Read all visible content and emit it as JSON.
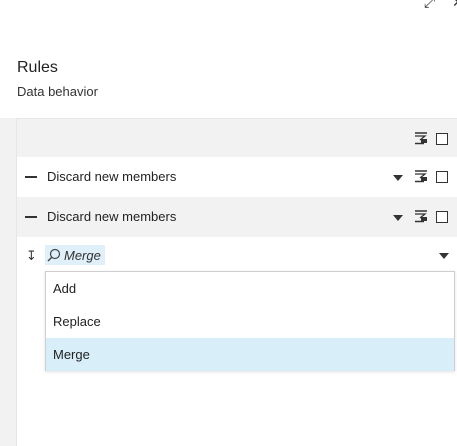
{
  "window": {
    "controls": [
      "expand-icon",
      "close-icon"
    ]
  },
  "panel": {
    "title": "Rules",
    "subtitle": "Data behavior"
  },
  "rows": [
    {
      "label": "Discard new members"
    },
    {
      "label": "Discard new members"
    }
  ],
  "search": {
    "value": "Merge"
  },
  "dropdown": {
    "options": [
      "Add",
      "Replace",
      "Merge"
    ],
    "selected": "Merge"
  },
  "colors": {
    "row_alt": "#f2f2f2",
    "highlight": "#d8eff9",
    "search_highlight": "#dff0fa"
  }
}
